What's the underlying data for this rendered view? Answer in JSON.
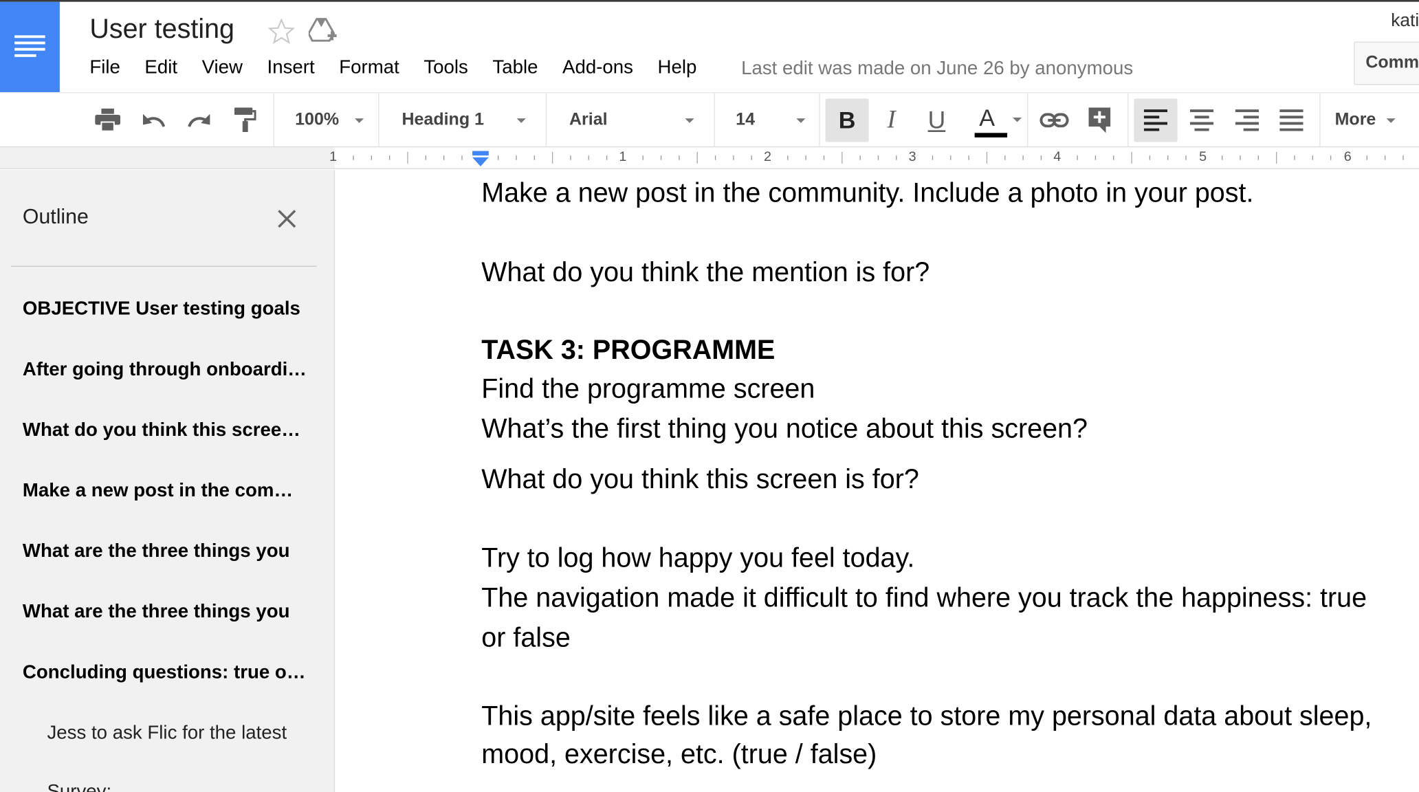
{
  "app": {
    "doc_title": "User testing",
    "user_name": "kati",
    "comments_label": "Comments"
  },
  "menu": [
    "File",
    "Edit",
    "View",
    "Insert",
    "Format",
    "Tools",
    "Table",
    "Add-ons",
    "Help"
  ],
  "last_edit": "Last edit was made on June 26 by anonymous",
  "toolbar": {
    "zoom": "100%",
    "style": "Heading 1",
    "font": "Arial",
    "size": "14",
    "bold": "B",
    "italic": "I",
    "underline": "U",
    "text_color": "A",
    "more": "More"
  },
  "ruler": {
    "numbers": [
      "1",
      "1",
      "2",
      "3",
      "4",
      "5",
      "6"
    ]
  },
  "sidebar": {
    "title": "Outline",
    "items": [
      "OBJECTIVE User testing goals",
      "After going through onboarding",
      "What do you think this screen is for?",
      "Make a new post in the community",
      "What are the three things you",
      "What are the three things you",
      "Concluding questions: true or false",
      "Jess to ask Flic for the latest",
      "Survey:"
    ]
  },
  "document": {
    "lines": [
      "Make a new post in the community. Include a photo in your post.",
      "What do you think the mention is for?",
      "TASK 3: PROGRAMME",
      "Find the programme screen",
      "What’s the first thing you notice about this screen?",
      "What do you think this screen is for?",
      "Try to log how happy you feel today.",
      "The navigation made it difficult to find where you track the happiness: true",
      "or false",
      "This app/site feels like a safe place to store my personal data about sleep,",
      "mood, exercise, etc. (true / false)"
    ]
  },
  "colors": {
    "brand": "#4285f4",
    "ruler_marker": "#4285f4",
    "active_button": "#e3e3e3",
    "sidebar_bg": "#f1f1f1"
  }
}
